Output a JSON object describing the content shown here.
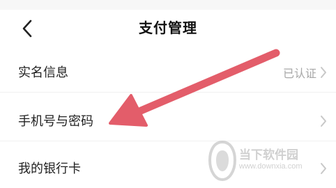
{
  "header": {
    "title": "支付管理"
  },
  "rows": [
    {
      "label": "实名信息",
      "value": "已认证"
    },
    {
      "label": "手机号与密码",
      "value": ""
    },
    {
      "label": "我的银行卡",
      "value": ""
    }
  ],
  "watermark": {
    "name": "当下软件园",
    "url": "www.downxia.com"
  },
  "colors": {
    "arrow": "#e35d6a",
    "value_text": "#a7a7a7",
    "title_text": "#111111"
  }
}
